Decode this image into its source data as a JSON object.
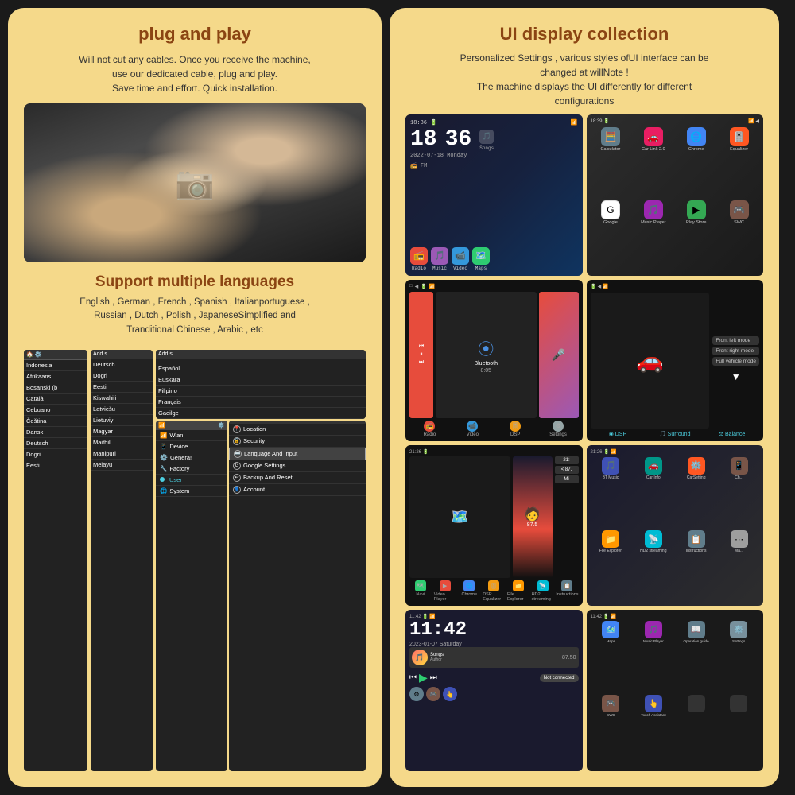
{
  "left_panel": {
    "plug_title": "plug and play",
    "plug_desc": "Will not cut any cables. Once you receive the machine,\nuse our dedicated cable, plug and play.\nSave time and effort. Quick installation.",
    "languages_title": "Support multiple languages",
    "languages_desc": "English , German , French , Spanish , Italianportuguese ,\nRussian , Dutch , Polish , JapaneseSimplified and\nTranditional Chinese , Arabic , etc",
    "language_list": [
      "Indonesia",
      "Afrikaans",
      "Bosanski (b",
      "Català",
      "Cebuano",
      "Čeština",
      "Dansk",
      "Deutsch",
      "Dogri"
    ],
    "language_list2": [
      "Deutsch",
      "Dogri",
      "Eesti",
      "Kiswahili",
      "Latviešu",
      "Lietuviy",
      "Magyar",
      "Maithili",
      "Manipuri",
      "Melayu"
    ],
    "language_list3": [
      "",
      "Español",
      "Euskara",
      "Filipino",
      "Français",
      "Gaeilge"
    ],
    "settings_menu": {
      "items_col1": [
        "Wlan",
        "Device",
        "General",
        "Factory",
        "User",
        "System"
      ],
      "items_col2": [
        "Location",
        "Security",
        "Lanquage And Input",
        "Google Settings",
        "Backup And Reset",
        "Account"
      ],
      "active_item": "User",
      "highlighted_item": "Lanquage And Input"
    }
  },
  "right_panel": {
    "title": "UI display collection",
    "desc": "Personalized Settings , various styles ofUI interface can be\nchanged at willNote !\nThe machine displays the UI differently for different\nconfigurations",
    "ui_screens": [
      {
        "id": "ui1",
        "time": "18 36",
        "date": "2022-07-18  Monday",
        "apps": [
          "Radio",
          "Music",
          "Video",
          "Maps"
        ]
      },
      {
        "id": "ui2",
        "time": "18:39",
        "apps": [
          "Calculator",
          "Car Link 2.0",
          "Chrome",
          "Equalizer",
          "Google",
          "Music Player",
          "Play Store",
          "SWC"
        ]
      },
      {
        "id": "ui3",
        "bluetooth": "Bluetooth",
        "time": "8:05",
        "apps": [
          "Radio",
          "Video",
          "DSP",
          "Settings"
        ]
      },
      {
        "id": "ui4",
        "modes": [
          "Front left mode",
          "Front right mode",
          "Full vehicle mode"
        ],
        "bottom": [
          "DSP",
          "Surround",
          "Balance"
        ]
      },
      {
        "id": "ui5",
        "time": "21:",
        "freq": "87.5",
        "apps": [
          "Navi",
          "Video Player",
          "Chrome",
          "DSP Equalizer",
          "File Explorer",
          "HD2 streaming",
          "Instructions"
        ]
      },
      {
        "id": "ui6",
        "time": "21:26",
        "apps": [
          "BT Music",
          "Car Info",
          "CarSetting",
          "File Explorer"
        ]
      },
      {
        "id": "ui7",
        "time": "11:42",
        "date": "2023-01-07  Saturday",
        "freq": "87.50",
        "apps": [
          "Settings",
          "SWC",
          "Touch Assistant"
        ]
      },
      {
        "id": "ui8",
        "time": "11:42",
        "apps": [
          "Maps",
          "Music Player",
          "Operation guide",
          "Settings",
          "SWC",
          "Touch Assistant"
        ]
      }
    ]
  },
  "colors": {
    "background": "#1a1a1a",
    "panel_bg": "#f5d98a",
    "title_color": "#8B4513",
    "accent_blue": "#4dd0e1",
    "accent_red": "#e74c3c"
  }
}
